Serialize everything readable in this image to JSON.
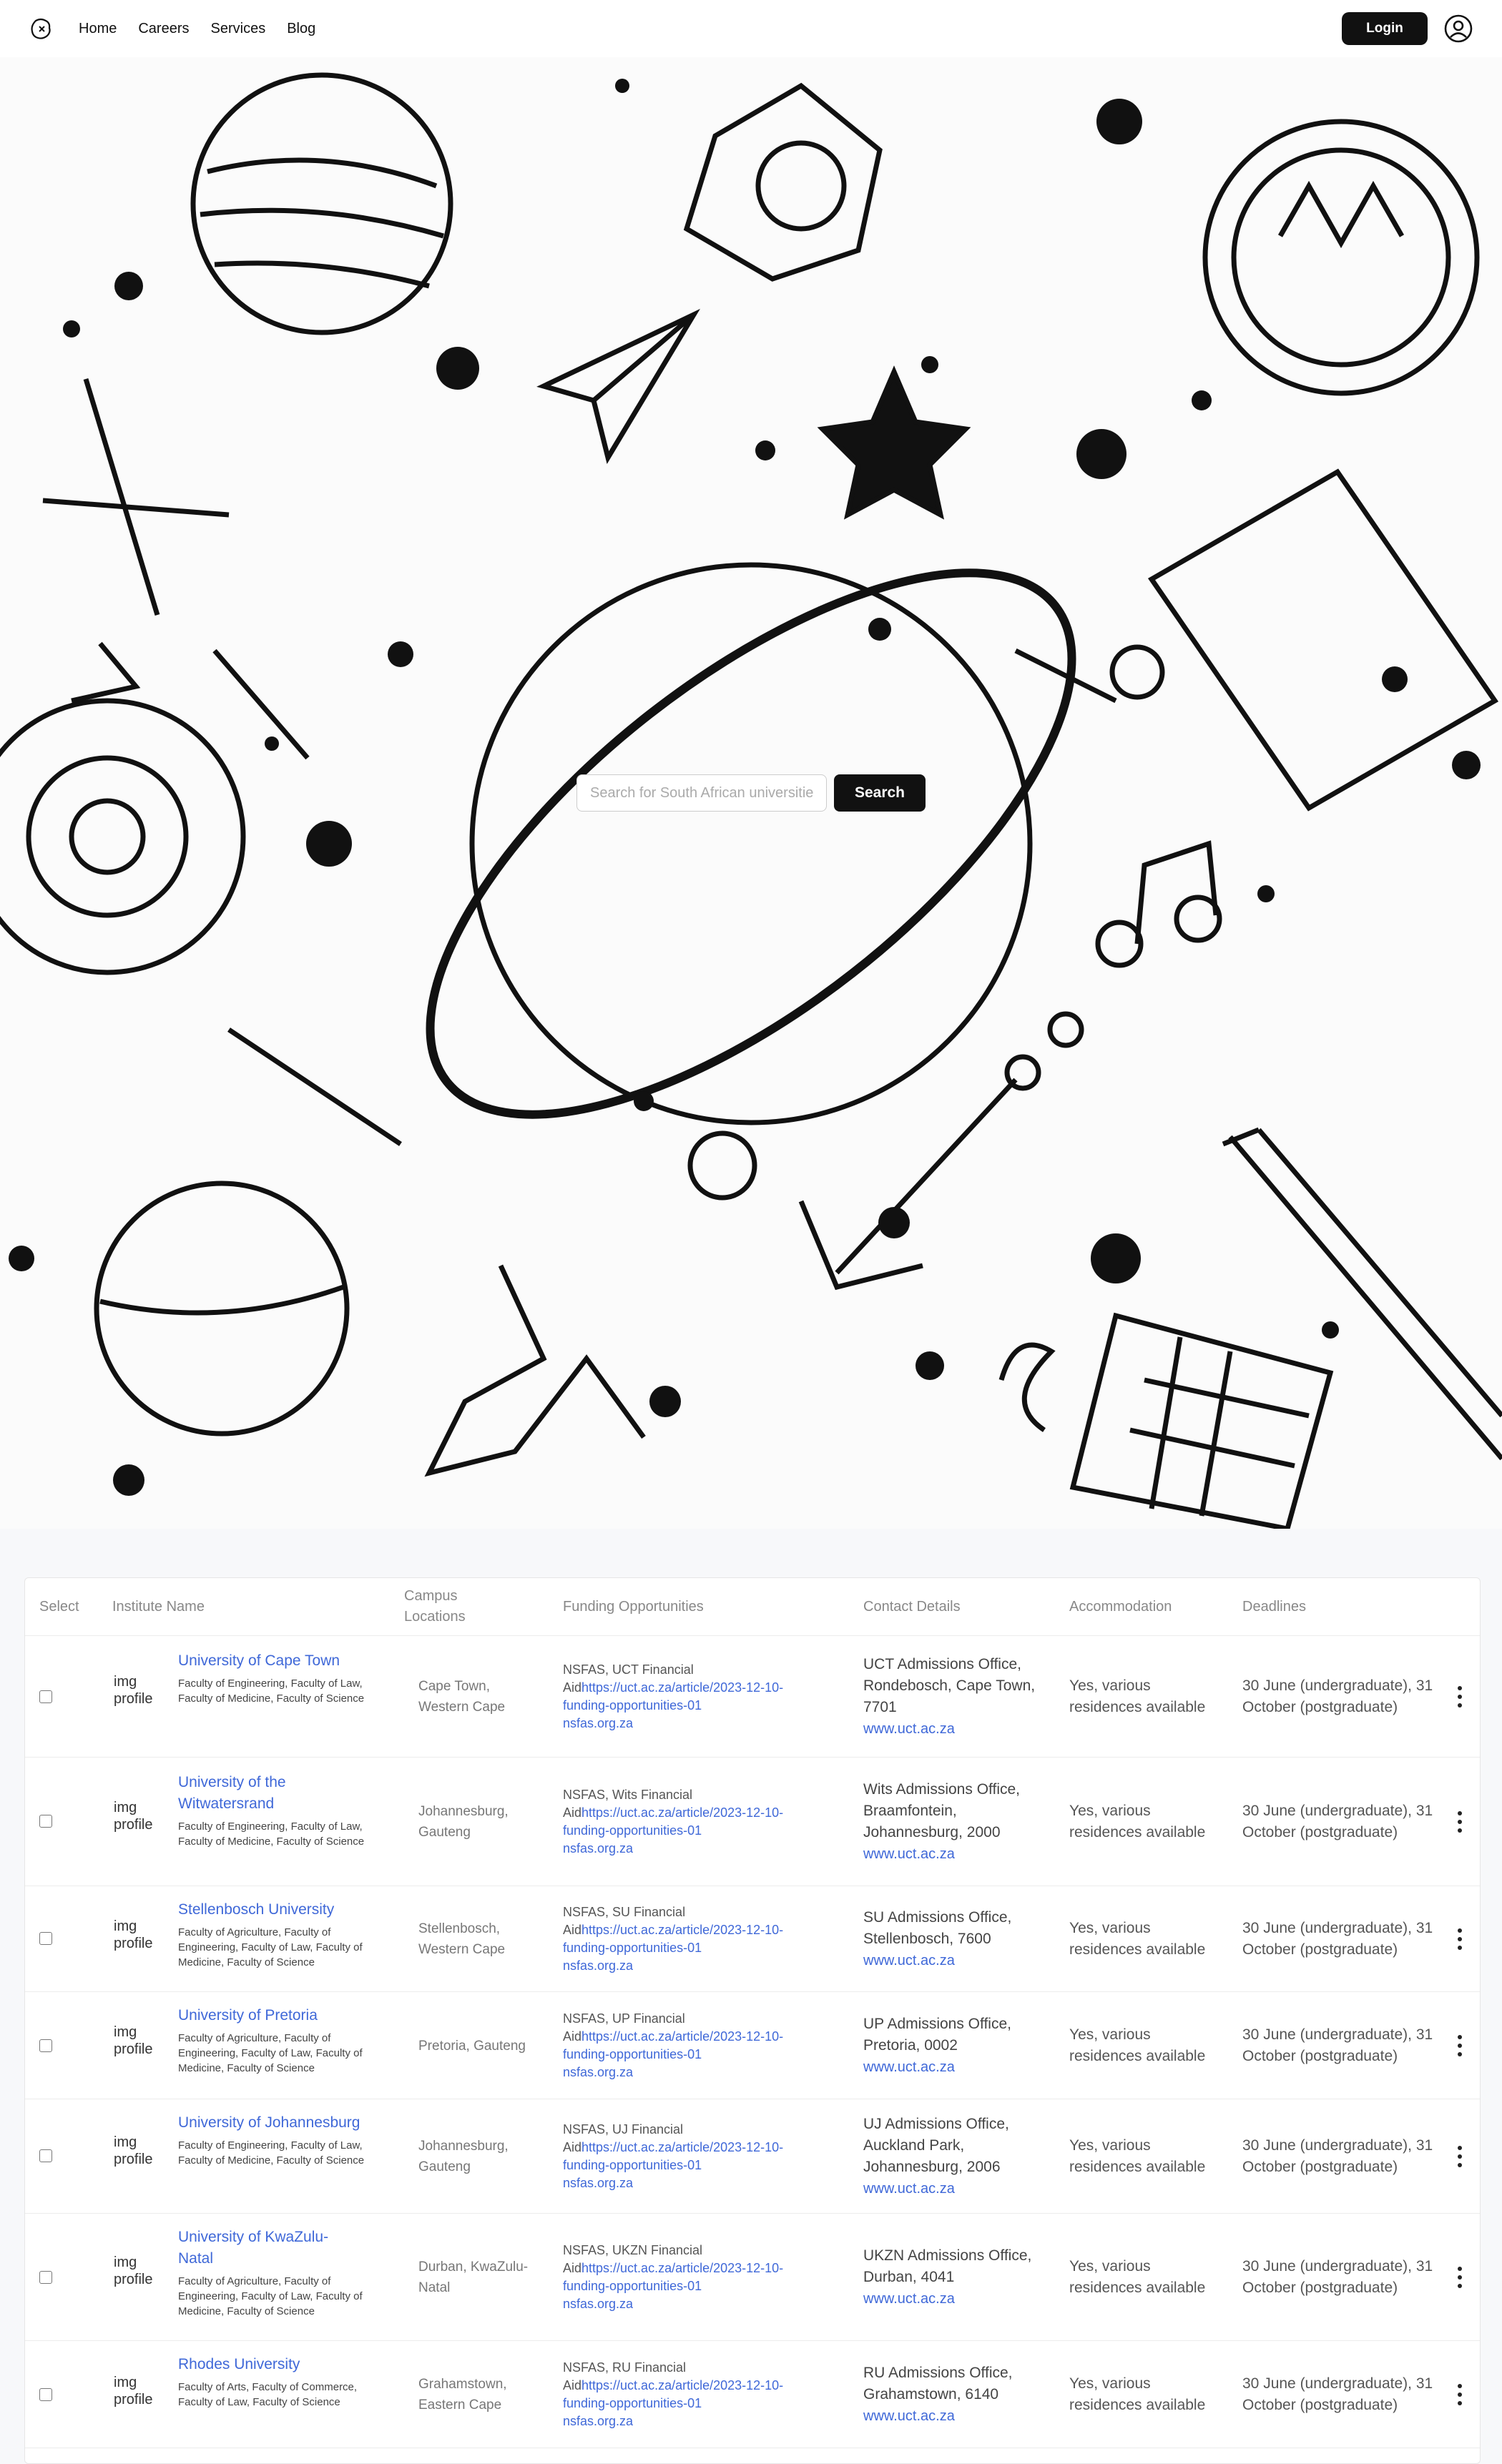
{
  "nav": {
    "links": [
      "Home",
      "Careers",
      "Services",
      "Blog"
    ],
    "login_label": "Login"
  },
  "search": {
    "placeholder": "Search for South African universities",
    "button_label": "Search"
  },
  "table": {
    "headers": {
      "select": "Select",
      "name": "Institute Name",
      "campus": "Campus Locations",
      "funding": "Funding Opportunities",
      "contact": "Contact Details",
      "accommodation": "Accommodation",
      "deadlines": "Deadlines"
    },
    "rows": [
      {
        "img_alt": "img profile",
        "name": "University of Cape Town",
        "faculties": "Faculty of Engineering, Faculty of Law, Faculty of Medicine, Faculty of Science",
        "campus": "Cape Town, Western Cape",
        "funding_text": "NSFAS, UCT Financial Aid",
        "funding_link": "https://uct.ac.za/article/2023-12-10-funding-opportunities-01",
        "funding_link2": "nsfas.org.za",
        "contact": "UCT Admissions Office, Rondebosch, Cape Town, 7701",
        "contact_link": "www.uct.ac.za",
        "accommodation": "Yes, various residences available",
        "deadlines": "30 June (undergraduate), 31 October (postgraduate)"
      },
      {
        "img_alt": "img profile",
        "name": "University of the Witwatersrand",
        "faculties": "Faculty of Engineering, Faculty of Law, Faculty of Medicine, Faculty of Science",
        "campus": "Johannesburg, Gauteng",
        "funding_text": "NSFAS, Wits Financial Aid",
        "funding_link": "https://uct.ac.za/article/2023-12-10-funding-opportunities-01",
        "funding_link2": "nsfas.org.za",
        "contact": "Wits Admissions Office, Braamfontein, Johannesburg, 2000",
        "contact_link": "www.uct.ac.za",
        "accommodation": "Yes, various residences available",
        "deadlines": "30 June (undergraduate), 31 October (postgraduate)"
      },
      {
        "img_alt": "img profile",
        "name": "Stellenbosch University",
        "faculties": "Faculty of Agriculture, Faculty of Engineering, Faculty of Law, Faculty of Medicine, Faculty of Science",
        "campus": "Stellenbosch, Western Cape",
        "funding_text": "NSFAS, SU Financial Aid",
        "funding_link": "https://uct.ac.za/article/2023-12-10-funding-opportunities-01",
        "funding_link2": "nsfas.org.za",
        "contact": "SU Admissions Office, Stellenbosch, 7600",
        "contact_link": "www.uct.ac.za",
        "accommodation": "Yes, various residences available",
        "deadlines": "30 June (undergraduate), 31 October (postgraduate)"
      },
      {
        "img_alt": "img profile",
        "name": "University of Pretoria",
        "faculties": "Faculty of Agriculture, Faculty of Engineering, Faculty of Law, Faculty of Medicine, Faculty of Science",
        "campus": "Pretoria, Gauteng",
        "funding_text": "NSFAS, UP Financial Aid",
        "funding_link": "https://uct.ac.za/article/2023-12-10-funding-opportunities-01",
        "funding_link2": "nsfas.org.za",
        "contact": "UP Admissions Office, Pretoria, 0002",
        "contact_link": "www.uct.ac.za",
        "accommodation": "Yes, various residences available",
        "deadlines": "30 June (undergraduate), 31 October (postgraduate)"
      },
      {
        "img_alt": "img profile",
        "name": "University of Johannesburg",
        "faculties": "Faculty of Engineering, Faculty of Law, Faculty of Medicine, Faculty of Science",
        "campus": "Johannesburg, Gauteng",
        "funding_text": "NSFAS, UJ Financial Aid",
        "funding_link": "https://uct.ac.za/article/2023-12-10-funding-opportunities-01",
        "funding_link2": "nsfas.org.za",
        "contact": "UJ Admissions Office, Auckland Park, Johannesburg, 2006",
        "contact_link": "www.uct.ac.za",
        "accommodation": "Yes, various residences available",
        "deadlines": "30 June (undergraduate), 31 October (postgraduate)"
      },
      {
        "img_alt": "img profile",
        "name": "University of KwaZulu-Natal",
        "faculties": "Faculty of Agriculture, Faculty of Engineering, Faculty of Law, Faculty of Medicine, Faculty of Science",
        "campus": "Durban, KwaZulu-Natal",
        "funding_text": "NSFAS, UKZN Financial Aid",
        "funding_link": "https://uct.ac.za/article/2023-12-10-funding-opportunities-01",
        "funding_link2": "nsfas.org.za",
        "contact": "UKZN Admissions Office, Durban, 4041",
        "contact_link": "www.uct.ac.za",
        "accommodation": "Yes, various residences available",
        "deadlines": "30 June (undergraduate), 31 October (postgraduate)"
      },
      {
        "img_alt": "img profile",
        "name": "Rhodes University",
        "faculties": "Faculty of Arts, Faculty of Commerce, Faculty of Law, Faculty of Science",
        "campus": "Grahamstown, Eastern Cape",
        "funding_text": "NSFAS, RU Financial Aid",
        "funding_link": "https://uct.ac.za/article/2023-12-10-funding-opportunities-01",
        "funding_link2": "nsfas.org.za",
        "contact": "RU Admissions Office, Grahamstown, 6140",
        "contact_link": "www.uct.ac.za",
        "accommodation": "Yes, various residences available",
        "deadlines": "30 June (undergraduate), 31 October (postgraduate)"
      }
    ]
  }
}
